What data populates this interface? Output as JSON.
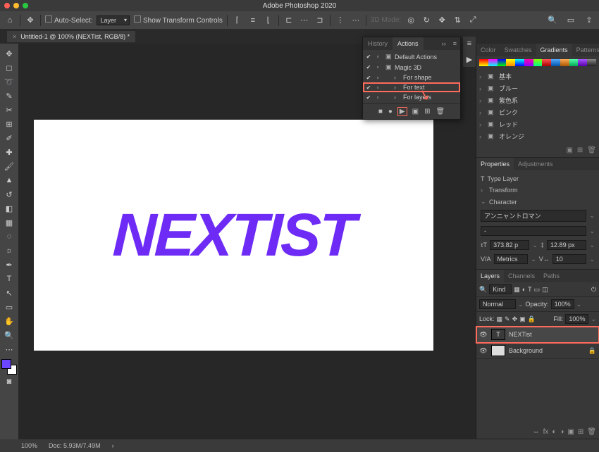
{
  "app_title": "Adobe Photoshop 2020",
  "options": {
    "auto_select_label": "Auto-Select:",
    "layer_sel": "Layer",
    "show_transform_label": "Show Transform Controls",
    "mode_label": "3D Mode:"
  },
  "doc_tab": "Untitled-1 @ 100% (NEXTist, RGB/8) *",
  "canvas_text": "NEXTIST",
  "actions_panel": {
    "tabs": [
      "History",
      "Actions"
    ],
    "items": [
      {
        "label": "Default Actions",
        "folder": true,
        "indent": 0
      },
      {
        "label": "Magic 3D",
        "folder": true,
        "open": true,
        "indent": 0
      },
      {
        "label": "For shape",
        "indent": 1
      },
      {
        "label": "For text",
        "indent": 1,
        "hl": true
      },
      {
        "label": "For layers",
        "indent": 1
      }
    ]
  },
  "right_panels": {
    "color_tabs": [
      "Color",
      "Swatches",
      "Gradients",
      "Patterns"
    ],
    "grad_folders": [
      "基本",
      "ブルー",
      "紫色系",
      "ピンク",
      "レッド",
      "オレンジ"
    ],
    "prop_tabs": [
      "Properties",
      "Adjustments"
    ],
    "type_layer": "Type Layer",
    "transform": "Transform",
    "character": "Character",
    "font_name": "アンニャントロマン",
    "font_style": "-",
    "font_size": "373.82 p",
    "leading": "12.89 px",
    "tracking": "Metrics",
    "vwidth": "10",
    "layer_tabs": [
      "Layers",
      "Channels",
      "Paths"
    ],
    "kind": "Kind",
    "blend": "Normal",
    "opacity_label": "Opacity:",
    "opacity": "100%",
    "lock_label": "Lock:",
    "fill_label": "Fill:",
    "fill": "100%",
    "layers": [
      {
        "name": "NEXTist",
        "type": "T",
        "hl": true
      },
      {
        "name": "Background",
        "type": "bg",
        "lock": true
      }
    ]
  },
  "status": {
    "zoom": "100%",
    "doc": "Doc: 5.93M/7.49M"
  }
}
